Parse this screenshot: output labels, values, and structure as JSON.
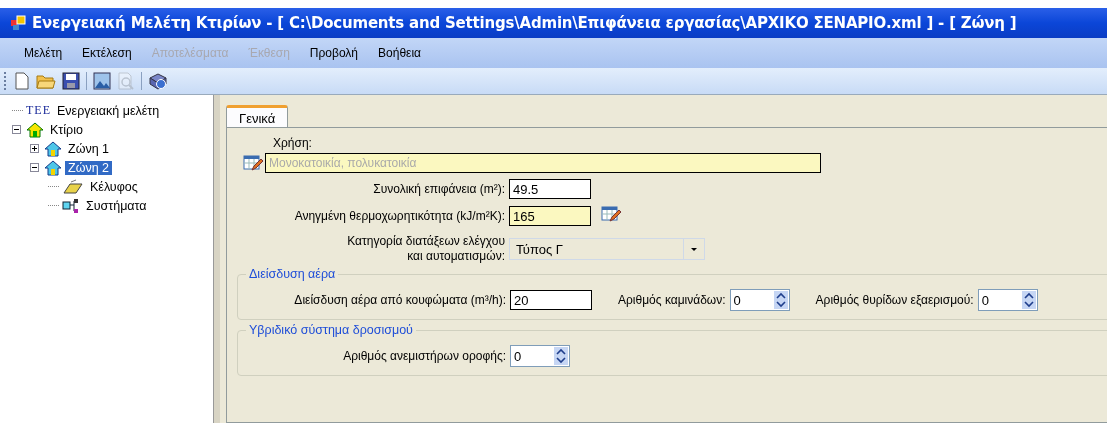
{
  "window": {
    "title": "Ενεργειακή Μελέτη Κτιρίων - [ C:\\Documents and Settings\\Admin\\Επιφάνεια εργασίας\\ΑΡΧΙΚΟ ΣΕΝΑΡΙΟ.xml ] - [ Ζώνη ]"
  },
  "menu": [
    {
      "label": "Μελέτη",
      "disabled": false
    },
    {
      "label": "Εκτέλεση",
      "disabled": false
    },
    {
      "label": "Αποτελέσματα",
      "disabled": true
    },
    {
      "label": "Έκθεση",
      "disabled": true
    },
    {
      "label": "Προβολή",
      "disabled": false
    },
    {
      "label": "Βοήθεια",
      "disabled": false
    }
  ],
  "toolbar": [
    {
      "kind": "new",
      "disabled": false
    },
    {
      "kind": "open",
      "disabled": false
    },
    {
      "kind": "save",
      "disabled": false
    },
    {
      "kind": "sep"
    },
    {
      "kind": "image",
      "disabled": false
    },
    {
      "kind": "preview",
      "disabled": true
    },
    {
      "kind": "sep"
    },
    {
      "kind": "help",
      "disabled": false
    }
  ],
  "tree": [
    {
      "kind": "tee",
      "badge": "TEE",
      "label": "Ενεργειακή μελέτη",
      "selected": false
    },
    {
      "kind": "building",
      "label": "Κτίριο",
      "expanded": true,
      "selected": false,
      "children": [
        {
          "kind": "zone",
          "label": "Ζώνη 1",
          "expanded": false,
          "selected": false
        },
        {
          "kind": "zone",
          "label": "Ζώνη 2",
          "expanded": true,
          "selected": true,
          "children": [
            {
              "kind": "shell",
              "label": "Κέλυφος",
              "selected": false
            },
            {
              "kind": "systems",
              "label": "Συστήματα",
              "selected": false
            }
          ]
        }
      ]
    }
  ],
  "tabs": [
    {
      "label": "Γενικά",
      "selected": true
    }
  ],
  "usage": {
    "label": "Χρήση:",
    "placeholder": "Μονοκατοικία, πολυκατοικία"
  },
  "fields": [
    {
      "label": "Συνολική επιφάνεια (m²):",
      "value": "49.5",
      "highlighted": false,
      "editor": false
    },
    {
      "label": "Ανηγμένη θερμοχωρητικότητα (kJ/m²K):",
      "value": "165",
      "highlighted": true,
      "editor": true
    }
  ],
  "category": {
    "label": "Κατηγορία διατάξεων ελέγχου και αυτοματισμών:",
    "value": "Τύπος Γ"
  },
  "groups": [
    {
      "title": "Διείσδυση αέρα",
      "items": [
        {
          "kind": "text",
          "label": "Διείσδυση αέρα από κουφώματα (m³/h):",
          "value": "20"
        },
        {
          "kind": "spin",
          "label": "Αριθμός καμινάδων:",
          "value": "0"
        },
        {
          "kind": "spin",
          "label": "Αριθμός θυρίδων εξαερισμού:",
          "value": "0"
        }
      ]
    },
    {
      "title": "Υβριδικό σύστημα δροσισμού",
      "items": [
        {
          "kind": "spin",
          "label": "Αριθμός ανεμιστήρων οροφής:",
          "value": "0"
        }
      ]
    }
  ]
}
